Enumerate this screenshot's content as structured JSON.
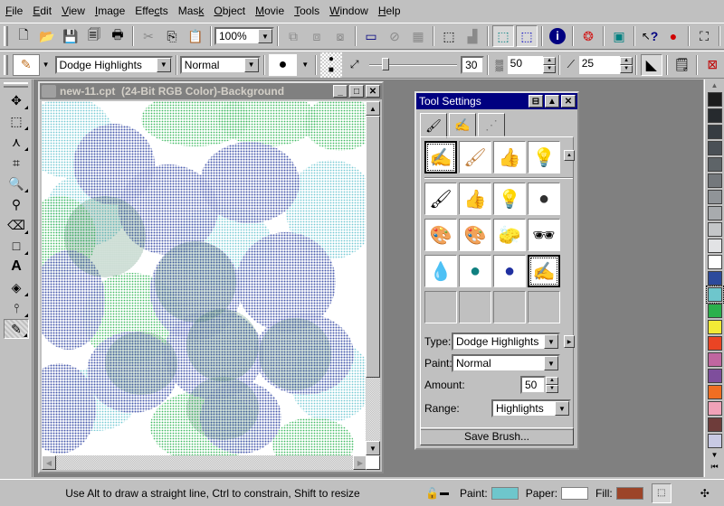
{
  "menu": [
    {
      "label": "File",
      "accel": "F"
    },
    {
      "label": "Edit",
      "accel": "E"
    },
    {
      "label": "View",
      "accel": "V"
    },
    {
      "label": "Image",
      "accel": "I"
    },
    {
      "label": "Effects",
      "accel": "c"
    },
    {
      "label": "Mask",
      "accel": "k"
    },
    {
      "label": "Object",
      "accel": "O"
    },
    {
      "label": "Movie",
      "accel": "M"
    },
    {
      "label": "Tools",
      "accel": "T"
    },
    {
      "label": "Window",
      "accel": "W"
    },
    {
      "label": "Help",
      "accel": "H"
    }
  ],
  "toolbar1": {
    "zoom_value": "100%",
    "buttons": [
      "new-icon",
      "open-icon",
      "save-icon",
      "save-as-icon",
      "print-icon",
      "cut-icon",
      "copy-icon",
      "paste-icon",
      "group-icon",
      "ungroup-icon",
      "combine-icon",
      "mask-icon",
      "mask-remove-icon",
      "mask-checkerboard-icon",
      "mask-edit-icon",
      "mask-mode-icon",
      "mask-marquee-icon",
      "mask-overlay-icon",
      "info-icon",
      "object-picker-icon",
      "objects-docker-icon",
      "whats-this-icon",
      "apple-icon",
      "fullscreen-icon"
    ]
  },
  "toolbar2": {
    "brush_type": "Dodge Highlights",
    "paint_mode": "Normal",
    "nib_size": "30",
    "transparency": "50",
    "soft_edge": "25"
  },
  "document": {
    "title": "new-11.cpt  (24-Bit RGB Color)-Background",
    "minimize": "_",
    "maximize": "□",
    "close": "✕"
  },
  "toolbox": [
    "pick-tool",
    "rectangle-mask-tool",
    "mask-transform-tool",
    "crop-tool",
    "zoom-tool",
    "eyedropper-tool",
    "eraser-tool",
    "rectangle-tool",
    "text-tool",
    "fill-tool",
    "effect-tool",
    "brush-tool"
  ],
  "tool_settings": {
    "title": "Tool Settings",
    "tabs": [
      "brush-settings-tab",
      "brush-nib-tab",
      "brush-stroke-tab"
    ],
    "recent": [
      "dodge-burn-icon",
      "brush-icon",
      "smear-icon",
      "lightbulb-icon"
    ],
    "presets": [
      "brush-icon",
      "smear-icon",
      "lightbulb-icon",
      "sphere-icon",
      "hue-left-icon",
      "hue-right-icon",
      "sponge-icon",
      "sunglasses-icon",
      "drops-icon",
      "teal-ball-icon",
      "blue-ball-icon",
      "dodge-burn-icon"
    ],
    "type_label": "Type:",
    "type_value": "Dodge Highlights",
    "paint_label": "Paint:",
    "paint_value": "Normal",
    "amount_label": "Amount:",
    "amount_value": "50",
    "range_label": "Range:",
    "range_value": "Highlights",
    "save_brush": "Save Brush..."
  },
  "palette": [
    "#1c1c1c",
    "#262a2e",
    "#363c42",
    "#4a5056",
    "#5e6468",
    "#74787c",
    "#909498",
    "#a8abae",
    "#c4c6c8",
    "#e2e3e5",
    "#ffffff",
    "#2c4a9c",
    "#6ec6cc",
    "#2ab04c",
    "#f2ea36",
    "#ea4424",
    "#c066a0",
    "#7e4e9c",
    "#f06e22",
    "#f0a2b8",
    "#6e3c3a",
    "#c8cae4"
  ],
  "status": {
    "hint": "Use Alt to draw a straight line, Ctrl to constrain, Shift to resize",
    "paint_label": "Paint:",
    "paint_color": "#6ec6cc",
    "paper_label": "Paper:",
    "paper_color": "#ffffff",
    "fill_label": "Fill:",
    "fill_color": "#9c4428"
  }
}
